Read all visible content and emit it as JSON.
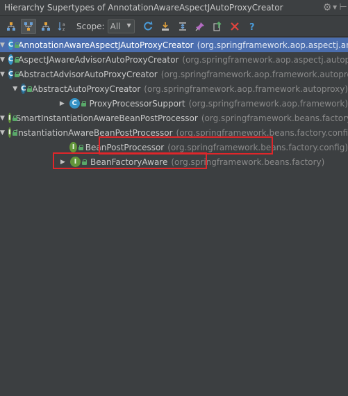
{
  "window": {
    "title": "Hierarchy Supertypes of AnnotationAwareAspectJAutoProxyCreator"
  },
  "titlebar_icons": {
    "settings": "gear-icon",
    "settings_caret": "caret-down-icon",
    "hide": "hide-panel-icon"
  },
  "toolbar": {
    "buttons": [
      {
        "name": "type-hierarchy-icon",
        "active": false
      },
      {
        "name": "supertypes-hierarchy-icon",
        "active": true
      },
      {
        "name": "subtypes-hierarchy-icon",
        "active": false
      },
      {
        "name": "sort-alphabetically-icon",
        "active": false
      }
    ],
    "scope_label": "Scope:",
    "scope_value": "All",
    "actions": [
      {
        "name": "refresh-icon"
      },
      {
        "name": "autoscroll-to-source-icon"
      },
      {
        "name": "expand-all-icon"
      },
      {
        "name": "pin-icon"
      },
      {
        "name": "export-icon"
      },
      {
        "name": "close-icon"
      },
      {
        "name": "help-icon"
      }
    ]
  },
  "tree": {
    "rows": [
      {
        "name": "AnnotationAwareAspectJAutoProxyCreator",
        "pkg": "(org.springframework.aop.aspectj.annotation)",
        "kind": "class",
        "expanded": true,
        "selected": true,
        "depth": 0
      },
      {
        "name": "AspectJAwareAdvisorAutoProxyCreator",
        "pkg": "(org.springframework.aop.aspectj.autoproxy)",
        "kind": "class",
        "expanded": true,
        "selected": false,
        "depth": 1
      },
      {
        "name": "AbstractAdvisorAutoProxyCreator",
        "pkg": "(org.springframework.aop.framework.autoproxy)",
        "kind": "abstract",
        "expanded": true,
        "selected": false,
        "depth": 2
      },
      {
        "name": "AbstractAutoProxyCreator",
        "pkg": "(org.springframework.aop.framework.autoproxy)",
        "kind": "abstract",
        "expanded": true,
        "selected": false,
        "depth": 3
      },
      {
        "name": "ProxyProcessorSupport",
        "pkg": "(org.springframework.aop.framework)",
        "kind": "class",
        "expanded": false,
        "selected": false,
        "depth": 4
      },
      {
        "name": "SmartInstantiationAwareBeanPostProcessor",
        "pkg": "(org.springframework.beans.factory.config)",
        "kind": "interface",
        "expanded": true,
        "selected": false,
        "depth": 4
      },
      {
        "name": "InstantiationAwareBeanPostProcessor",
        "pkg": "(org.springframework.beans.factory.config)",
        "kind": "interface",
        "expanded": true,
        "selected": false,
        "depth": 5
      },
      {
        "name": "BeanPostProcessor",
        "pkg": "(org.springframework.beans.factory.config)",
        "kind": "interface",
        "expanded": null,
        "selected": false,
        "depth": 6
      },
      {
        "name": "BeanFactoryAware",
        "pkg": "(org.springframework.beans.factory)",
        "kind": "interface",
        "expanded": false,
        "selected": false,
        "depth": 4
      }
    ]
  },
  "colors": {
    "background": "#3c3f41",
    "selection": "#4b6eaf",
    "highlight_border": "#e0262a",
    "class_icon": "#3592c4",
    "interface_icon": "#62963a"
  }
}
